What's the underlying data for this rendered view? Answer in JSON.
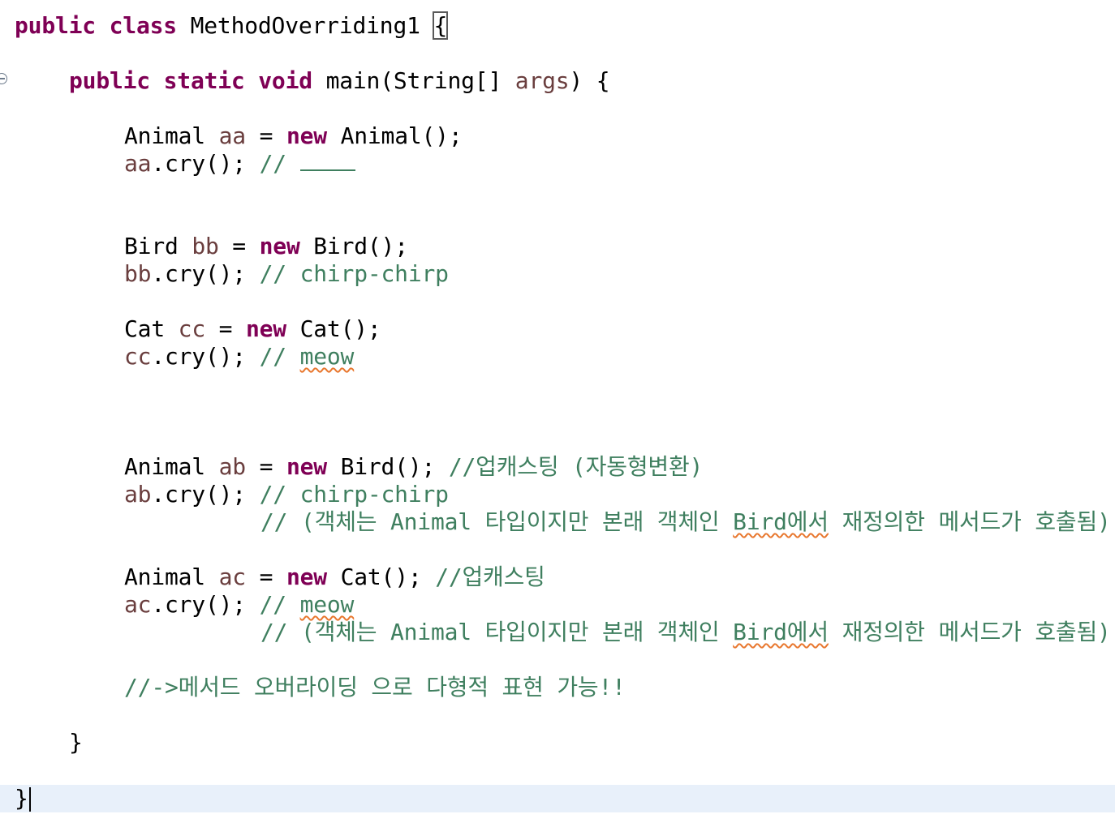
{
  "editor": {
    "lines": {
      "l1": {
        "kw1": "public",
        "kw2": "class",
        "name": "MethodOverriding1",
        "brace": "{"
      },
      "l2": {
        "kw1": "public",
        "kw2": "static",
        "kw3": "void",
        "sig_a": "main(String[] ",
        "arg": "args",
        "sig_b": ") {"
      },
      "l3": {
        "type": "Animal",
        "var": "aa",
        "eq": " = ",
        "kw": "new",
        "rest": " Animal();"
      },
      "l4": {
        "var": "aa",
        "rest": ".cry(); ",
        "comment": "// "
      },
      "l5": {
        "type": "Bird",
        "var": "bb",
        "eq": " = ",
        "kw": "new",
        "rest": " Bird();"
      },
      "l6": {
        "var": "bb",
        "rest": ".cry(); ",
        "comment": "// chirp-chirp"
      },
      "l7": {
        "type": "Cat",
        "var": "cc",
        "eq": " = ",
        "kw": "new",
        "rest": " Cat();"
      },
      "l8": {
        "var": "cc",
        "rest": ".cry(); ",
        "comment": "// ",
        "word": "meow"
      },
      "l9": {
        "type": "Animal",
        "var": "ab",
        "eq": " = ",
        "kw": "new",
        "rest": " Bird(); ",
        "comment": "//업캐스팅 (자동형변환)"
      },
      "l10": {
        "var": "ab",
        "rest": ".cry(); ",
        "comment": "// chirp-chirp"
      },
      "l11": {
        "comment_a": "// (객체는 Animal 타입이지만 본래 객체인 ",
        "word": "Bird에서",
        "comment_b": " 재정의한 메서드가 호출됨)"
      },
      "l12": {
        "type": "Animal",
        "var": "ac",
        "eq": " = ",
        "kw": "new",
        "rest": " Cat(); ",
        "comment": "//업캐스팅"
      },
      "l13": {
        "var": "ac",
        "rest": ".cry(); ",
        "comment": "// ",
        "word": "meow"
      },
      "l14": {
        "comment_a": "// (객체는 Animal 타입이지만 본래 객체인 ",
        "word": "Bird에서",
        "comment_b": " 재정의한 메서드가 호출됨)"
      },
      "l15": {
        "comment": "//->메서드 오버라이딩 으로 다형적 표현 가능!!"
      },
      "l16": {
        "brace": "}"
      },
      "l17": {
        "brace": "}"
      }
    },
    "colors": {
      "keyword": "#7f0055",
      "local_variable": "#6a3e3e",
      "comment": "#3f7f5f",
      "current_line": "#e8f0fa",
      "spell_squiggle": "#e8772e"
    }
  }
}
